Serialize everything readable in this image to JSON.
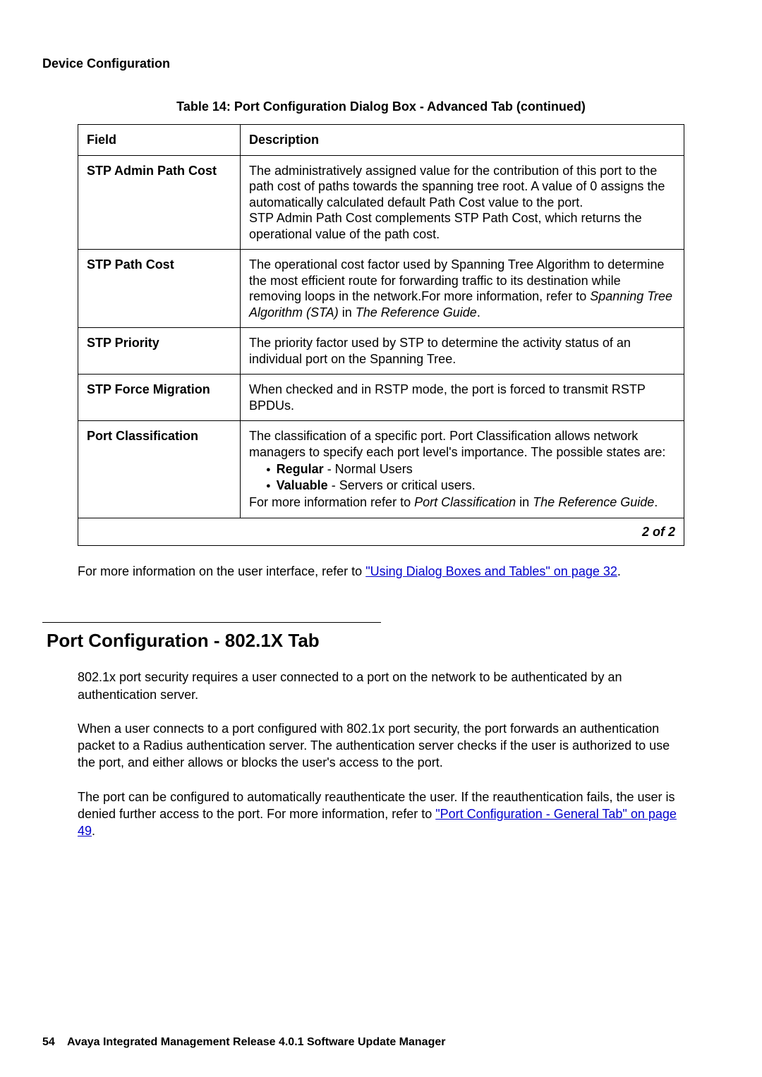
{
  "header": "Device Configuration",
  "table_caption": "Table 14: Port Configuration Dialog Box - Advanced Tab (continued)",
  "columns": {
    "field": "Field",
    "description": "Description"
  },
  "rows": {
    "r0": {
      "field": "STP Admin Path Cost",
      "desc_p1": "The administratively assigned value for the contribution of this port to the path cost of paths towards the spanning tree root. A value of 0 assigns the automatically calculated default Path Cost value to the port.",
      "desc_p2": "STP Admin Path Cost complements STP Path Cost, which returns the operational value of the path cost."
    },
    "r1": {
      "field": "STP Path Cost",
      "desc_pre": "The operational cost factor used by Spanning Tree Algorithm to determine the most efficient route for forwarding traffic to its destination while removing loops in the network.For more information, refer to ",
      "desc_em1": "Spanning Tree Algorithm (STA)",
      "desc_mid": " in ",
      "desc_em2": "The Reference Guide",
      "desc_post": "."
    },
    "r2": {
      "field": "STP Priority",
      "desc": "The priority factor used by STP to determine the activity status of an individual port on the Spanning Tree."
    },
    "r3": {
      "field": "STP Force Migration",
      "desc": "When checked and in RSTP mode, the port is forced to transmit RSTP BPDUs."
    },
    "r4": {
      "field": "Port Classification",
      "desc_intro": "The classification of a specific port. Port Classification allows network managers to specify each port level's importance. The possible states are:",
      "bullet1_bold": "Regular",
      "bullet1_rest": " - Normal Users",
      "bullet2_bold": "Valuable",
      "bullet2_rest": " - Servers or critical users.",
      "desc_more_pre": "For more information refer to ",
      "desc_more_em1": "Port Classification",
      "desc_more_mid": " in ",
      "desc_more_em2": "The Reference Guide",
      "desc_more_post": "."
    }
  },
  "pagecount": "2 of 2",
  "para1_pre": "For more information on the user interface, refer to ",
  "para1_link": "\"Using Dialog Boxes and Tables\" on page 32",
  "para1_post": ".",
  "section_heading": "Port Configuration - 802.1X Tab",
  "para2": "802.1x port security requires a user connected to a port on the network to be authenticated by an authentication server.",
  "para3": "When a user connects to a port configured with 802.1x port security, the port forwards an authentication packet to a Radius authentication server. The authentication server checks if the user is authorized to use the port, and either allows or blocks the user's access to the port.",
  "para4_pre": "The port can be configured to automatically reauthenticate the user. If the reauthentication fails, the user is denied further access to the port. For more information, refer to ",
  "para4_link": "\"Port Configuration - General Tab\" on page 49",
  "para4_post": ".",
  "footer_page": "54",
  "footer_text": "Avaya Integrated Management Release 4.0.1 Software Update Manager"
}
